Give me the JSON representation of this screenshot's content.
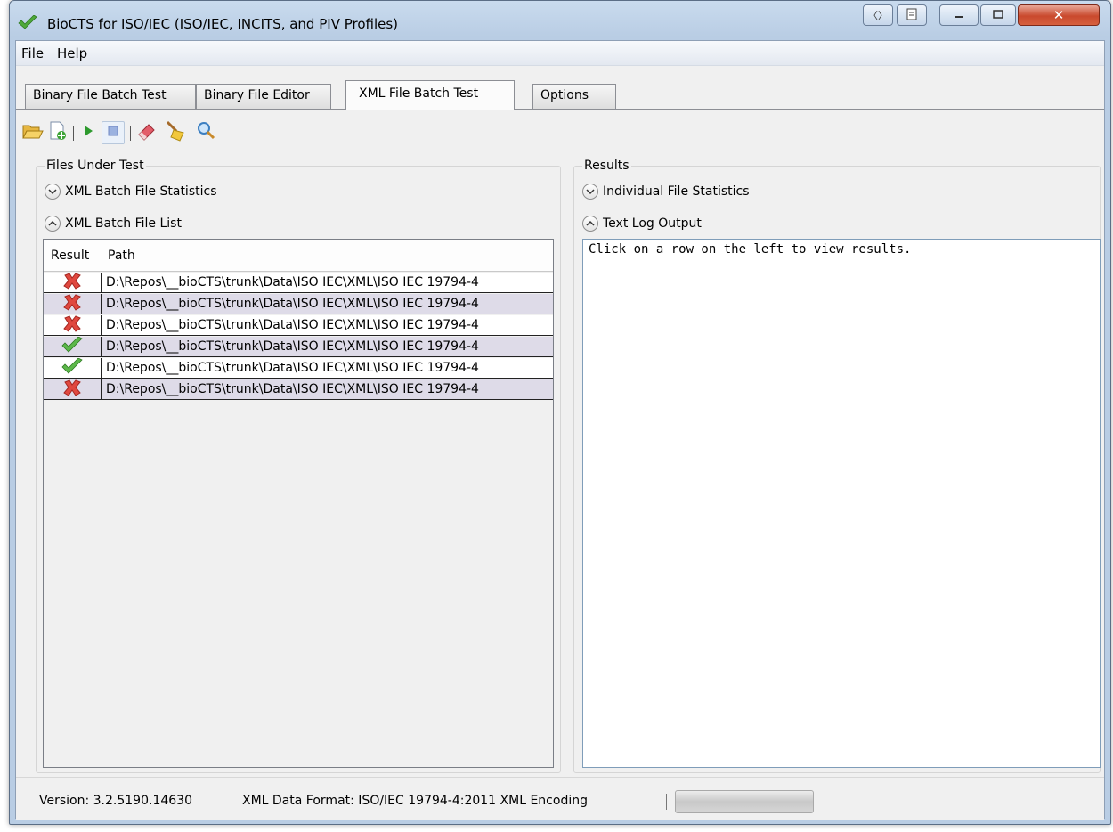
{
  "window": {
    "title": "BioCTS for ISO/IEC (ISO/IEC, INCITS, and PIV Profiles)",
    "accent_color": "#06b025"
  },
  "menu": {
    "items": [
      "File",
      "Help"
    ]
  },
  "tabs": [
    {
      "label": "Binary File Batch Test",
      "active": false
    },
    {
      "label": "Binary File Editor",
      "active": false
    },
    {
      "label": "XML File Batch Test",
      "active": true
    },
    {
      "label": "Options",
      "active": false
    }
  ],
  "toolbar": {
    "icons": [
      "open-folder-icon",
      "add-file-icon",
      "play-icon",
      "stop-icon",
      "eraser-icon",
      "broom-icon",
      "magnifier-icon"
    ]
  },
  "left_panel": {
    "group_label": "Files Under Test",
    "stats_expander": "XML Batch File Statistics",
    "list_expander": "XML Batch File List",
    "columns": [
      "Result",
      "Path"
    ],
    "rows": [
      {
        "result": "fail",
        "path": "D:\\Repos\\__bioCTS\\trunk\\Data\\ISO IEC\\XML\\ISO IEC 19794-4"
      },
      {
        "result": "fail",
        "path": "D:\\Repos\\__bioCTS\\trunk\\Data\\ISO IEC\\XML\\ISO IEC 19794-4"
      },
      {
        "result": "fail",
        "path": "D:\\Repos\\__bioCTS\\trunk\\Data\\ISO IEC\\XML\\ISO IEC 19794-4"
      },
      {
        "result": "pass",
        "path": "D:\\Repos\\__bioCTS\\trunk\\Data\\ISO IEC\\XML\\ISO IEC 19794-4"
      },
      {
        "result": "pass",
        "path": "D:\\Repos\\__bioCTS\\trunk\\Data\\ISO IEC\\XML\\ISO IEC 19794-4"
      },
      {
        "result": "fail",
        "path": "D:\\Repos\\__bioCTS\\trunk\\Data\\ISO IEC\\XML\\ISO IEC 19794-4"
      }
    ]
  },
  "right_panel": {
    "group_label": "Results",
    "stats_expander": "Individual File Statistics",
    "log_expander": "Text Log Output",
    "log_text": "Click on a row on the left to view results."
  },
  "status": {
    "version": "Version: 3.2.5190.14630",
    "format": "XML Data Format: ISO/IEC 19794-4:2011 XML Encoding",
    "progress": 0
  }
}
